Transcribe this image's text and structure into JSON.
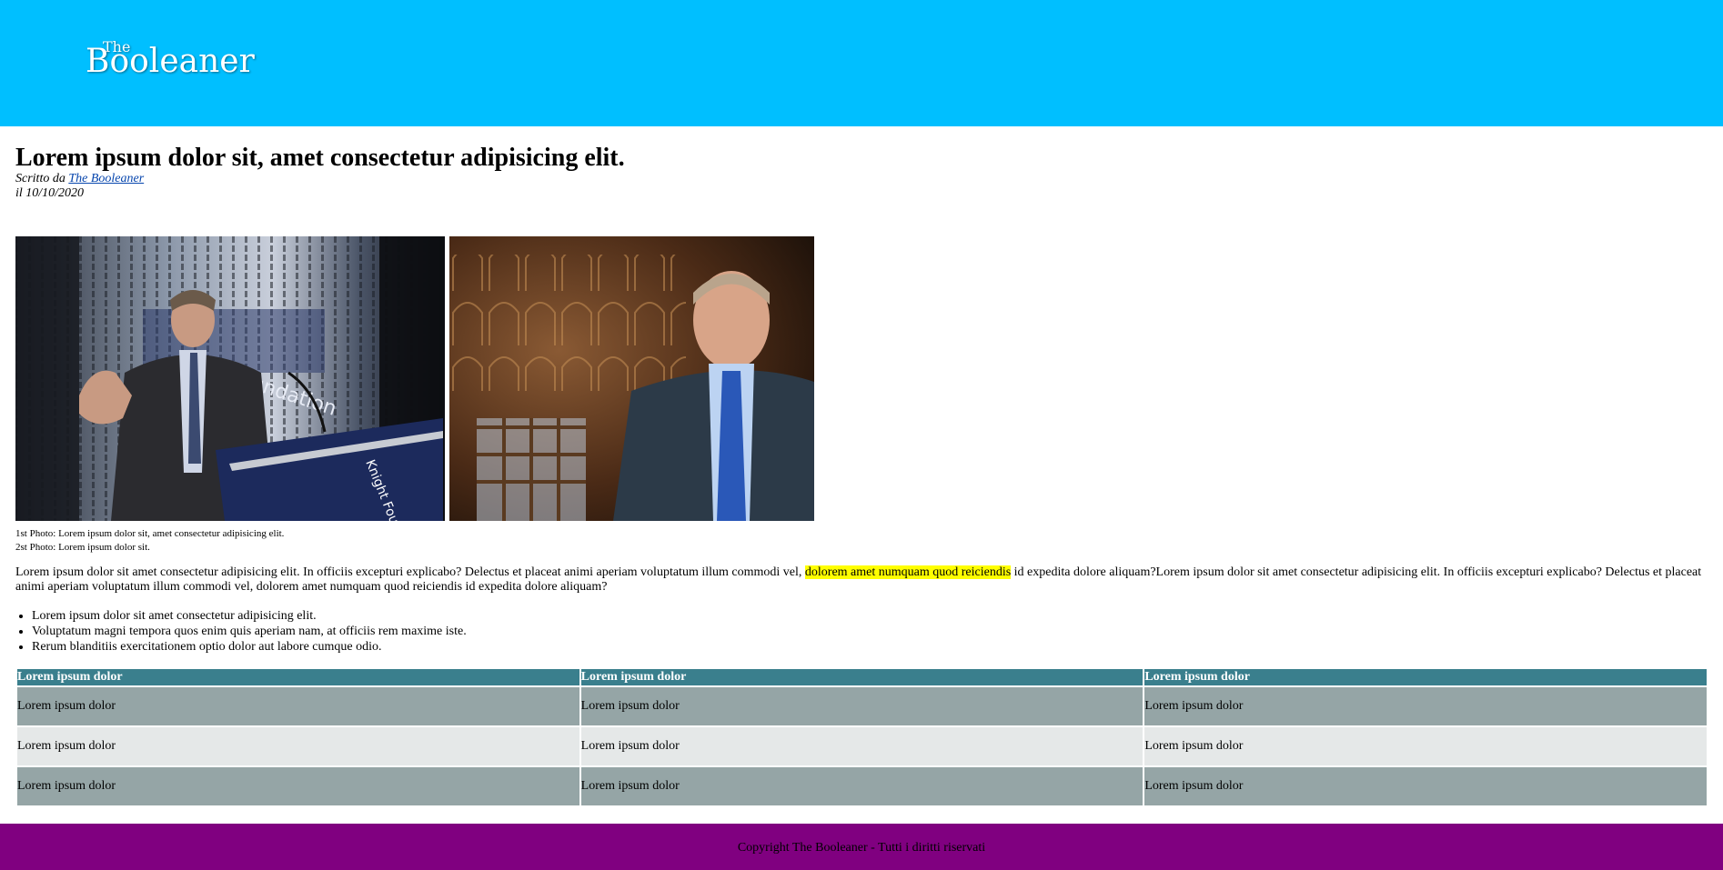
{
  "header": {
    "background_color": "#00bfff",
    "logo_the": "The",
    "logo_main": "Booleaner"
  },
  "article": {
    "title": "Lorem ipsum dolor sit, amet consectetur adipisicing elit.",
    "byline_prefix": "Scritto da ",
    "author_link": "The Booleaner",
    "date": "il 10/10/2020",
    "captions": [
      "1st Photo: Lorem ipsum dolor sit, amet consectetur adipisicing elit.",
      "2st Photo: Lorem ipsum dolor sit."
    ],
    "paragraph": {
      "before": "Lorem ipsum dolor sit amet consectetur adipisicing elit. In officiis excepturi explicabo? Delectus et placeat animi aperiam voluptatum illum commodi vel, ",
      "highlight": "dolorem amet numquam quod reiciendis",
      "after": " id expedita dolore aliquam?Lorem ipsum dolor sit amet consectetur adipisicing elit. In officiis excepturi explicabo? Delectus et placeat animi aperiam voluptatum illum commodi vel, dolorem amet numquam quod reiciendis id expedita dolore aliquam?"
    },
    "bullets": [
      "Lorem ipsum dolor sit amet consectetur adipisicing elit.",
      "Voluptatum magni tempora quos enim quis aperiam nam, at officiis rem maxime iste.",
      "Rerum blanditiis exercitationem optio dolor aut labore cumque odio."
    ]
  },
  "table": {
    "headers": [
      "Lorem ipsum dolor",
      "Lorem ipsum dolor",
      "Lorem ipsum dolor"
    ],
    "rows": [
      [
        "Lorem ipsum dolor",
        "Lorem ipsum dolor",
        "Lorem ipsum dolor"
      ],
      [
        "Lorem ipsum dolor",
        "Lorem ipsum dolor",
        "Lorem ipsum dolor"
      ],
      [
        "Lorem ipsum dolor",
        "Lorem ipsum dolor",
        "Lorem ipsum dolor"
      ]
    ],
    "header_color": "#3a7f8d",
    "odd_row_color": "#95a5a6",
    "even_row_color": "#e5e8e8"
  },
  "footer": {
    "text": "Copyright The Booleaner - Tutti i diritti riservati",
    "background_color": "#800080"
  }
}
